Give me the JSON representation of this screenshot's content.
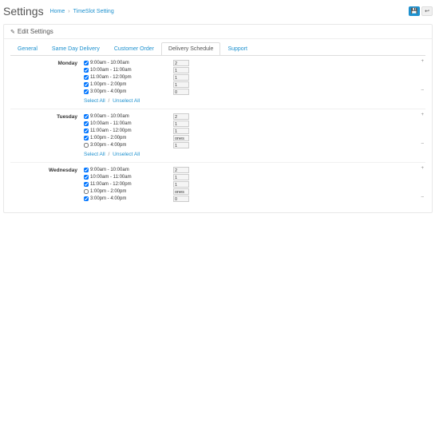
{
  "header": {
    "title": "Settings",
    "breadcrumbs": [
      "Home",
      "TimeSlot Setting"
    ]
  },
  "buttons": {
    "save_icon": "✔",
    "cancel_icon": "↩"
  },
  "panel": {
    "title": "Edit Settings",
    "icon": "✎"
  },
  "tabs": [
    "General",
    "Same Day Delivery",
    "Customer Order",
    "Delivery Schedule",
    "Support"
  ],
  "active_tab": 3,
  "links": {
    "select_all": "Select All",
    "unselect_all": "Unselect All",
    "sep": "/"
  },
  "days": [
    {
      "name": "Monday",
      "slots": [
        {
          "label": "9:00am - 10:00am",
          "checked": true,
          "value": "2"
        },
        {
          "label": "10:00am - 11:00am",
          "checked": true,
          "value": "1"
        },
        {
          "label": "11:00am - 12:00pm",
          "checked": true,
          "value": "1"
        },
        {
          "label": "1:00pm - 2:00pm",
          "checked": true,
          "value": "1"
        },
        {
          "label": "3:00pm - 4:00pm",
          "checked": true,
          "value": "0"
        }
      ]
    },
    {
      "name": "Tuesday",
      "slots": [
        {
          "label": "9:00am - 10:00am",
          "checked": true,
          "value": "2"
        },
        {
          "label": "10:00am - 11:00am",
          "checked": true,
          "value": "1"
        },
        {
          "label": "11:00am - 12:00pm",
          "checked": true,
          "value": "1"
        },
        {
          "label": "1:00pm - 2:00pm",
          "checked": true,
          "value": "ones"
        },
        {
          "label": "3:00pm - 4:00pm",
          "checked": false,
          "value": "1"
        }
      ]
    },
    {
      "name": "Wednesday",
      "slots": [
        {
          "label": "9:00am - 10:00am",
          "checked": true,
          "value": "2"
        },
        {
          "label": "10:00am - 11:00am",
          "checked": true,
          "value": "1"
        },
        {
          "label": "11:00am - 12:00pm",
          "checked": true,
          "value": "1"
        },
        {
          "label": "1:00pm - 2:00pm",
          "checked": false,
          "value": "ones"
        },
        {
          "label": "3:00pm - 4:00pm",
          "checked": true,
          "value": "0"
        }
      ]
    }
  ]
}
